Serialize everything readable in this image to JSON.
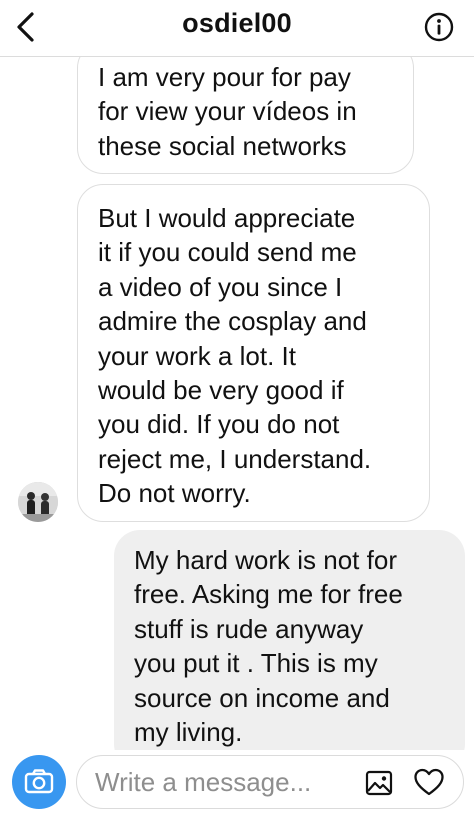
{
  "header": {
    "title": "osdiel00",
    "back_icon": "chevron-left-icon",
    "info_icon": "info-circle-icon"
  },
  "messages": [
    {
      "direction": "incoming",
      "text": "I am very pour for  pay\nfor view your vídeos in\nthese social networks"
    },
    {
      "direction": "incoming",
      "text": "But I would appreciate\nit if you could send me\na video of you since I\nadmire the cosplay and\nyour work a lot. It\nwould be very good if\nyou did. If you do not\nreject me, I understand.\nDo not worry."
    },
    {
      "direction": "outgoing",
      "text": "My hard work is not for\nfree. Asking me for free\nstuff is rude anyway\nyou put it . This is my\nsource on income and\nmy living."
    }
  ],
  "composer": {
    "placeholder": "Write a message...",
    "camera_icon": "camera-icon",
    "gallery_icon": "image-gallery-icon",
    "like_icon": "heart-icon"
  },
  "colors": {
    "accent": "#3897f0",
    "outgoing_bubble": "#efefef",
    "incoming_border": "#dedede",
    "placeholder": "#8e8e8e"
  }
}
